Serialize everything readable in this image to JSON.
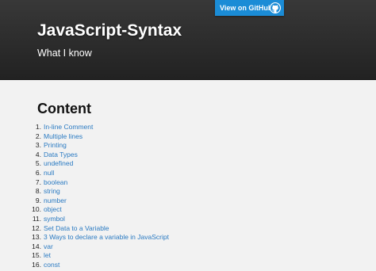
{
  "header": {
    "github_button_label": "View on GitHub",
    "title": "JavaScript-Syntax",
    "subtitle": "What I know"
  },
  "content": {
    "heading": "Content",
    "items": [
      {
        "num": "1.",
        "label": "In-line Comment"
      },
      {
        "num": "2.",
        "label": "Multiple lines"
      },
      {
        "num": "3.",
        "label": "Printing"
      },
      {
        "num": "4.",
        "label": "Data Types"
      },
      {
        "num": "5.",
        "label": "undefined"
      },
      {
        "num": "6.",
        "label": "null"
      },
      {
        "num": "7.",
        "label": "boolean"
      },
      {
        "num": "8.",
        "label": "string"
      },
      {
        "num": "9.",
        "label": "number"
      },
      {
        "num": "10.",
        "label": "object"
      },
      {
        "num": "11.",
        "label": "symbol"
      },
      {
        "num": "12.",
        "label": "Set Data to a Variable"
      },
      {
        "num": "13.",
        "label": "3 Ways to declare a variable in JavaScript"
      },
      {
        "num": "14.",
        "label": "var"
      },
      {
        "num": "15.",
        "label": "let"
      },
      {
        "num": "16.",
        "label": "const"
      }
    ]
  },
  "colors": {
    "header_bg": "#2b2b2b",
    "accent_button": "#1b8cd6",
    "link": "#2a7ac2",
    "page_bg": "#f2f2f2"
  },
  "icons": {
    "github": "github-octocat-icon"
  }
}
